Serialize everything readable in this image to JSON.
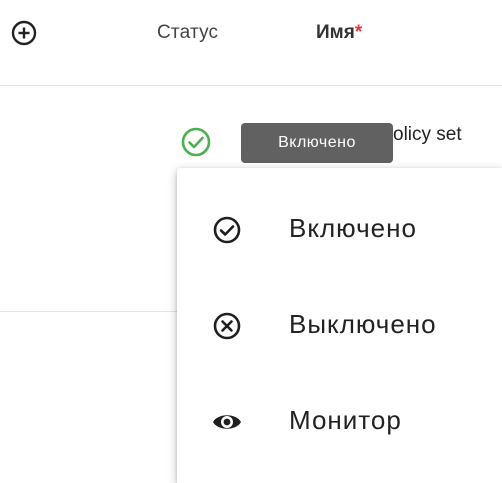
{
  "header": {
    "add_icon": "circle-plus-icon",
    "status_label": "Статус",
    "name_label": "Имя",
    "required_mark": "*",
    "required_color": "#e53935"
  },
  "row": {
    "status_icon": "check-circle-icon",
    "status_color": "#4caf50",
    "policy_text": "olicy set"
  },
  "tooltip": {
    "text": "Включено"
  },
  "menu": {
    "items": [
      {
        "label": "Включено",
        "icon": "check-circle-outline-icon"
      },
      {
        "label": "Выключено",
        "icon": "x-circle-outline-icon"
      },
      {
        "label": "Монитор",
        "icon": "eye-icon"
      }
    ]
  }
}
